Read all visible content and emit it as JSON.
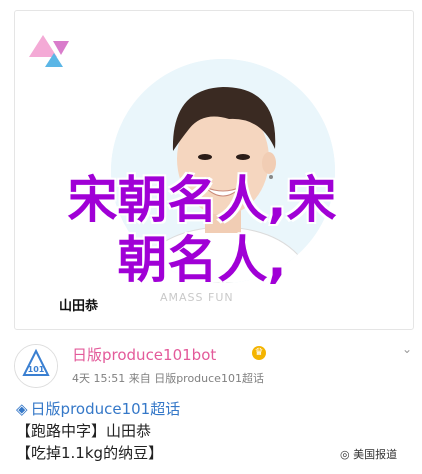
{
  "photo": {
    "name_caption": "山田恭",
    "watermark": "AMASS FUN"
  },
  "overlay": {
    "line1": "宋朝名人,宋",
    "line2": "朝名人,"
  },
  "post": {
    "author": "日版produce101bot",
    "meta": "4天 15:51  来自 日版produce101超话",
    "tag_line": "日版produce101超话",
    "line2": "【跑路中字】山田恭",
    "line3": "【吃掉1.1kg的纳豆】",
    "wechat": "美国报道"
  },
  "colors": {
    "overlay_text": "#a000d6",
    "author": "#e35a9a",
    "tag": "#3578c8"
  }
}
